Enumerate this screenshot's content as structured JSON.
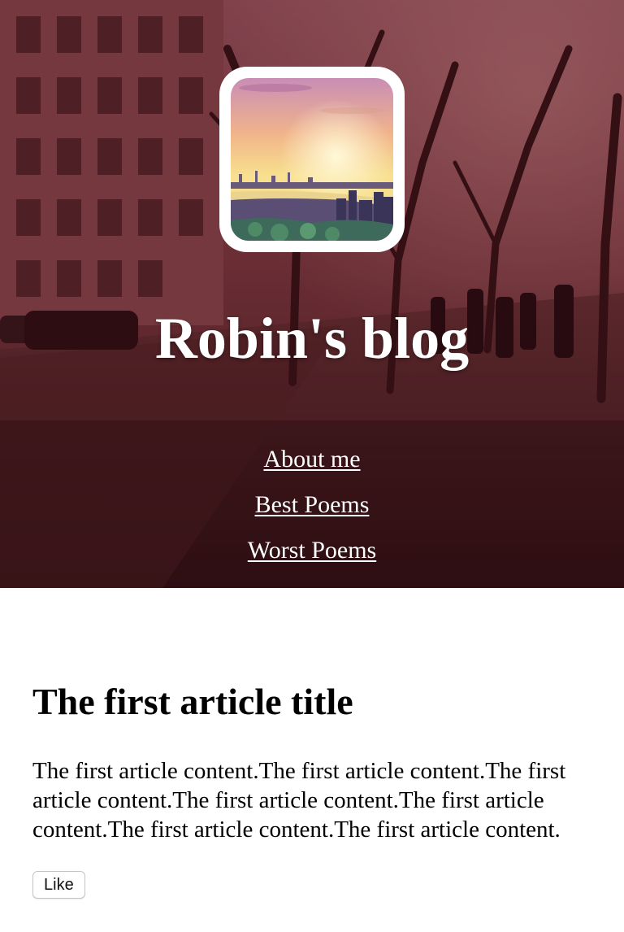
{
  "header": {
    "title": "Robin's blog",
    "background_tint": "#5a1f28",
    "avatar_alt": "city-harbor-sunset-photo"
  },
  "nav": {
    "items": [
      {
        "label": "About me"
      },
      {
        "label": "Best Poems"
      },
      {
        "label": "Worst Poems"
      }
    ]
  },
  "article": {
    "title": "The first article title",
    "content": "The first article content.The first article content.The first article content.The first article content.The first article content.The first article content.The first article content.",
    "like_label": "Like"
  }
}
